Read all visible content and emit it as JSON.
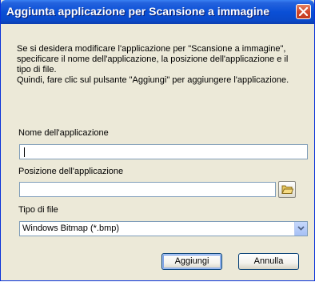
{
  "dialog": {
    "title": "Aggiunta applicazione per Scansione a immagine",
    "description_line1": "Se si desidera modificare l'applicazione per \"Scansione a immagine\", specificare il nome dell'applicazione, la posizione dell'applicazione e il tipo di file.",
    "description_line2": "Quindi, fare clic sul pulsante \"Aggiungi\" per aggiungere l'applicazione."
  },
  "fields": {
    "app_name_label": "Nome dell'applicazione",
    "app_name_value": "",
    "app_location_label": "Posizione dell'applicazione",
    "app_location_value": "",
    "file_type_label": "Tipo di file",
    "file_type_selected": "Windows Bitmap (*.bmp)"
  },
  "buttons": {
    "add_label": "Aggiungi",
    "cancel_label": "Annulla"
  },
  "icons": {
    "close": "close-icon",
    "browse": "folder-icon",
    "dropdown": "chevron-down-icon"
  },
  "colors": {
    "titlebar": "#0a4fd6",
    "close_button": "#d2472c",
    "dialog_background": "#ece9d8",
    "input_border": "#7f9db9"
  }
}
